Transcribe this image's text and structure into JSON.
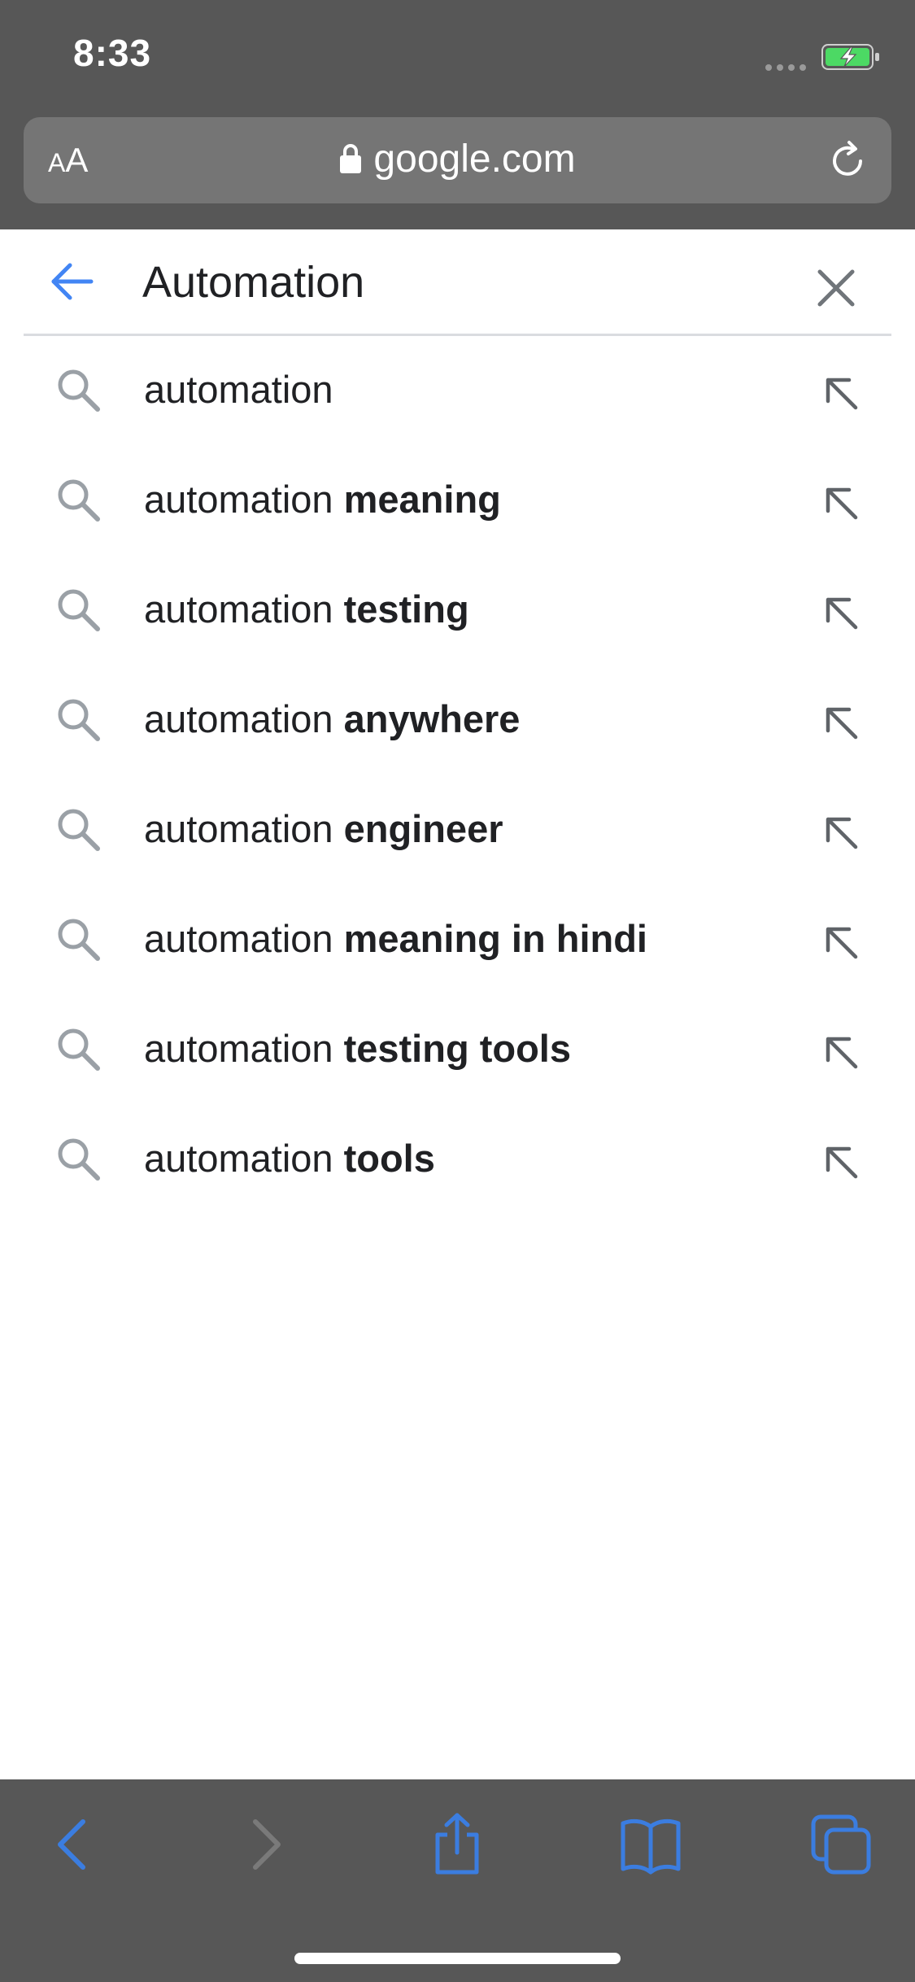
{
  "status_bar": {
    "time": "8:33"
  },
  "browser": {
    "text_size_button": {
      "small": "A",
      "large": "A"
    },
    "url": "google.com",
    "icons": {
      "lock": "lock-icon",
      "reload": "reload-icon"
    }
  },
  "search": {
    "query": "Automation",
    "back_icon": "arrow-left-icon",
    "clear_icon": "close-icon"
  },
  "suggestions": [
    {
      "prefix": "automation",
      "completion": ""
    },
    {
      "prefix": "automation",
      "completion": " meaning"
    },
    {
      "prefix": "automation",
      "completion": " testing"
    },
    {
      "prefix": "automation",
      "completion": " anywhere"
    },
    {
      "prefix": "automation",
      "completion": " engineer"
    },
    {
      "prefix": "automation",
      "completion": " meaning in hindi"
    },
    {
      "prefix": "automation",
      "completion": " testing tools"
    },
    {
      "prefix": "automation",
      "completion": " tools"
    }
  ],
  "toolbar": {
    "items": [
      "back-icon",
      "forward-icon",
      "share-icon",
      "bookmarks-icon",
      "tabs-icon"
    ]
  },
  "colors": {
    "chrome": "#575757",
    "address_bar": "#757575",
    "accent_blue": "#4285f4",
    "toolbar_blue": "#3b7de0",
    "text_primary": "#202124",
    "icon_gray": "#9aa0a6",
    "battery_green": "#4cd964"
  }
}
